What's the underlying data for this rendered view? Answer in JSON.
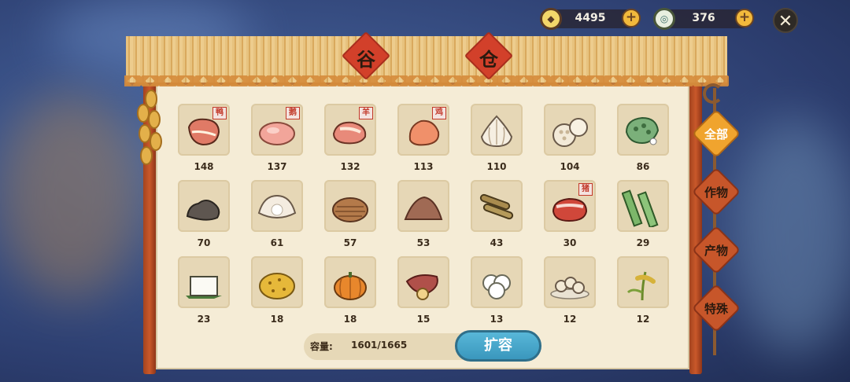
{
  "currency": [
    {
      "icon": "gold-coin-icon",
      "value": "4495"
    },
    {
      "icon": "jade-coin-icon",
      "value": "376"
    }
  ],
  "title": [
    "谷",
    "仓"
  ],
  "items": [
    {
      "icon": "duck-meat",
      "tag": "鸭",
      "count": "148"
    },
    {
      "icon": "goose-meat",
      "tag": "鹅",
      "count": "137"
    },
    {
      "icon": "mutton",
      "tag": "羊",
      "count": "132"
    },
    {
      "icon": "chicken-meat",
      "tag": "鸡",
      "count": "113"
    },
    {
      "icon": "garlic",
      "tag": "",
      "count": "110"
    },
    {
      "icon": "lotus-root",
      "tag": "",
      "count": "104"
    },
    {
      "icon": "lotus-seed-pod",
      "tag": "",
      "count": "86"
    },
    {
      "icon": "coal",
      "tag": "",
      "count": "70"
    },
    {
      "icon": "pearl-shell",
      "tag": "",
      "count": "61"
    },
    {
      "icon": "taro",
      "tag": "",
      "count": "57"
    },
    {
      "icon": "soil",
      "tag": "",
      "count": "53"
    },
    {
      "icon": "wood-logs",
      "tag": "",
      "count": "43"
    },
    {
      "icon": "pork",
      "tag": "猪",
      "count": "30"
    },
    {
      "icon": "bamboo",
      "tag": "",
      "count": "29"
    },
    {
      "icon": "tofu",
      "tag": "",
      "count": "23"
    },
    {
      "icon": "rapeseed",
      "tag": "",
      "count": "18"
    },
    {
      "icon": "pumpkin",
      "tag": "",
      "count": "18"
    },
    {
      "icon": "sweet-potato",
      "tag": "",
      "count": "15"
    },
    {
      "icon": "cotton",
      "tag": "",
      "count": "13"
    },
    {
      "icon": "dumplings",
      "tag": "",
      "count": "12"
    },
    {
      "icon": "rice-plant",
      "tag": "",
      "count": "12"
    }
  ],
  "capacity": {
    "label": "容量:",
    "value": "1601/1665",
    "button": "扩容"
  },
  "tabs": [
    {
      "label": "全部",
      "active": true
    },
    {
      "label": "作物",
      "active": false
    },
    {
      "label": "产物",
      "active": false
    },
    {
      "label": "特殊",
      "active": false
    }
  ],
  "colors": {
    "panel": "#f5ecd6",
    "accent": "#d2402a",
    "button": "#3a97bd",
    "tab_active": "#f0a42e"
  }
}
